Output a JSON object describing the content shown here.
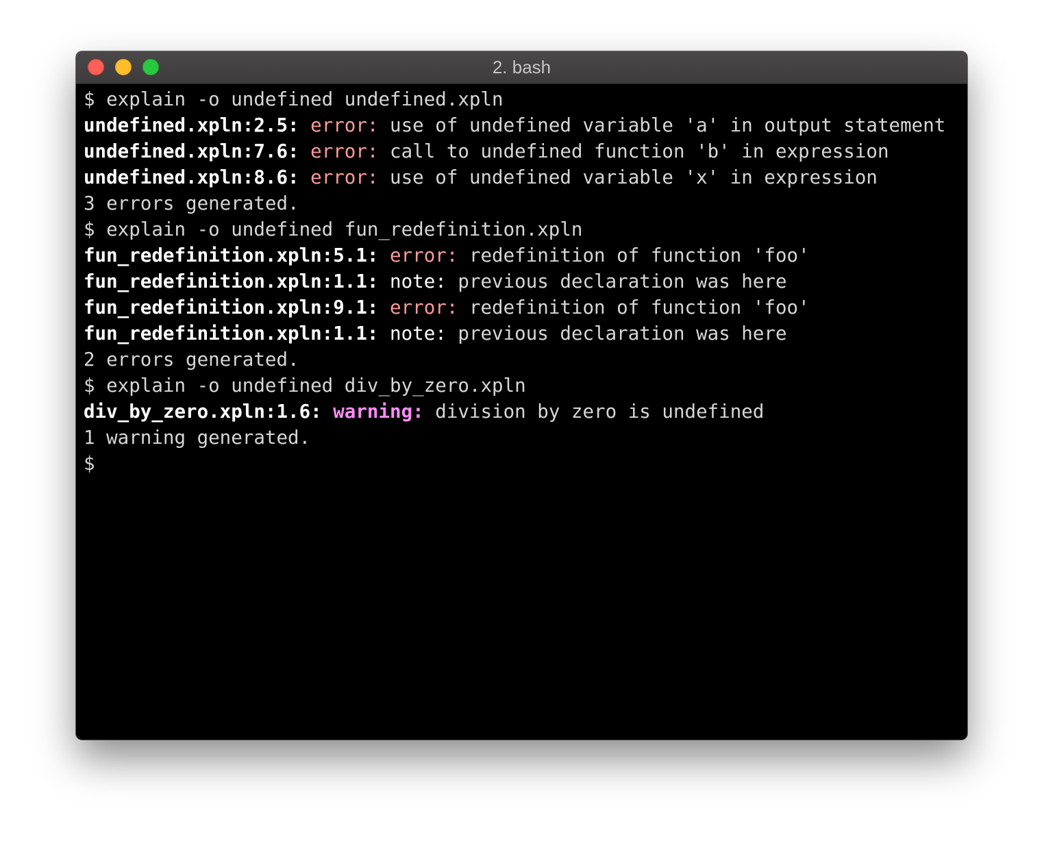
{
  "window": {
    "title": "2. bash"
  },
  "terminal": {
    "lines": [
      {
        "type": "plain",
        "text": "$ explain -o undefined undefined.xpln"
      },
      {
        "type": "diag",
        "loc": "undefined.xpln:2.5:",
        "kind": "error:",
        "kind_class": "err",
        "msg": "use of undefined variable 'a' in output statement"
      },
      {
        "type": "diag",
        "loc": "undefined.xpln:7.6:",
        "kind": "error:",
        "kind_class": "err",
        "msg": "call to undefined function 'b' in expression"
      },
      {
        "type": "diag",
        "loc": "undefined.xpln:8.6:",
        "kind": "error:",
        "kind_class": "err",
        "msg": "use of undefined variable 'x' in expression"
      },
      {
        "type": "plain",
        "text": "3 errors generated."
      },
      {
        "type": "plain",
        "text": "$ explain -o undefined fun_redefinition.xpln"
      },
      {
        "type": "diag",
        "loc": "fun_redefinition.xpln:5.1:",
        "kind": "error:",
        "kind_class": "err",
        "msg": "redefinition of function 'foo'"
      },
      {
        "type": "diag",
        "loc": "fun_redefinition.xpln:1.1:",
        "kind": "note:",
        "kind_class": "note",
        "msg": "previous declaration was here"
      },
      {
        "type": "diag",
        "loc": "fun_redefinition.xpln:9.1:",
        "kind": "error:",
        "kind_class": "err",
        "msg": "redefinition of function 'foo'"
      },
      {
        "type": "diag",
        "loc": "fun_redefinition.xpln:1.1:",
        "kind": "note:",
        "kind_class": "note",
        "msg": "previous declaration was here"
      },
      {
        "type": "plain",
        "text": "2 errors generated."
      },
      {
        "type": "plain",
        "text": "$ explain -o undefined div_by_zero.xpln"
      },
      {
        "type": "diag",
        "loc": "div_by_zero.xpln:1.6:",
        "kind": "warning:",
        "kind_class": "warn",
        "msg": "division by zero is undefined"
      },
      {
        "type": "plain",
        "text": "1 warning generated."
      },
      {
        "type": "plain",
        "text": "$"
      }
    ]
  },
  "colors": {
    "error": "#ff9a9a",
    "warning": "#ff8cf5",
    "note": "#ffffff",
    "text": "#d6d6d6",
    "background": "#000000"
  }
}
